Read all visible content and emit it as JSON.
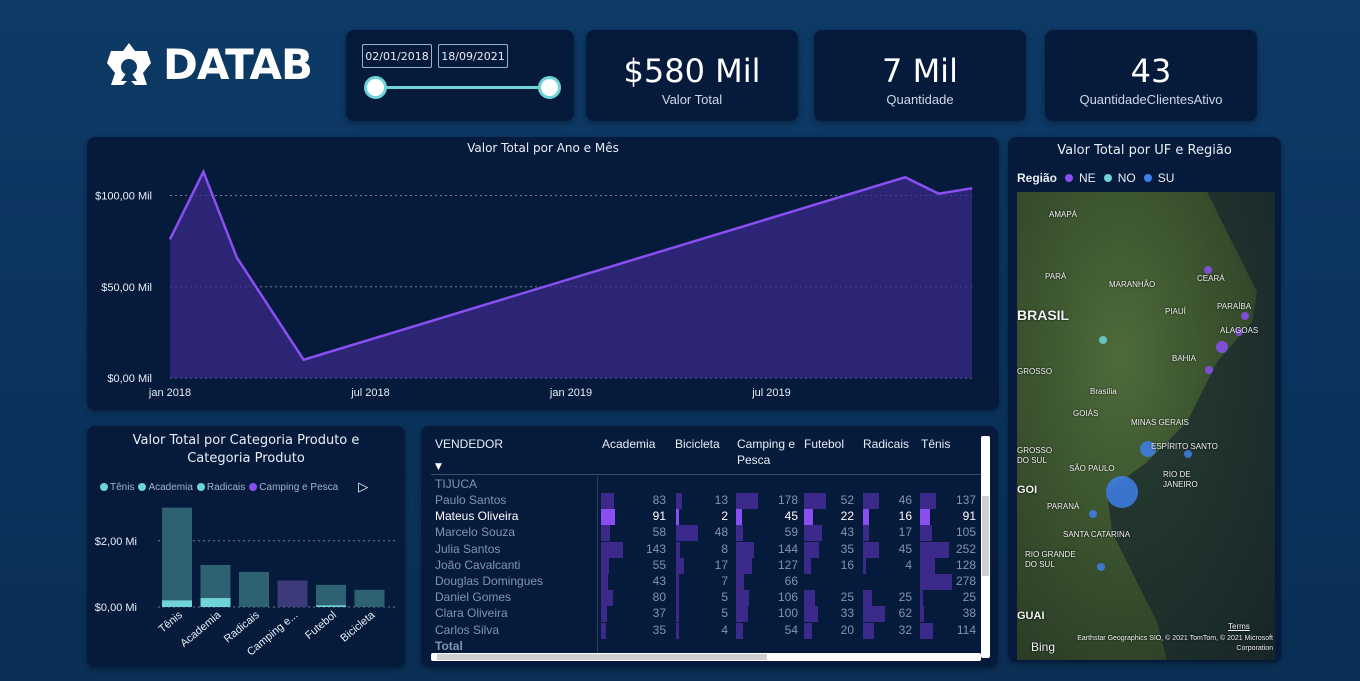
{
  "logo": {
    "text": "DATAB"
  },
  "date_slicer": {
    "start": "02/01/2018",
    "end": "18/09/2021"
  },
  "kpis": [
    {
      "value": "$580 Mil",
      "label": "Valor Total"
    },
    {
      "value": "7 Mil",
      "label": "Quantidade"
    },
    {
      "value": "43",
      "label": "QuantidadeClientesAtivo"
    }
  ],
  "colors": {
    "accent_purple": "#8a4ff0",
    "teal": "#6fd4d6",
    "panel": "#061a3c"
  },
  "chart_data": [
    {
      "type": "area",
      "title": "Valor Total por Ano e Mês",
      "x": [
        "2018-01",
        "2018-02",
        "2018-03",
        "2018-05",
        "2019-11",
        "2019-12",
        "2020-01"
      ],
      "values": [
        76,
        113,
        66,
        10,
        110,
        101,
        104
      ],
      "ylim": [
        0,
        120
      ],
      "yticks": [
        "$0,00 Mil",
        "$50,00 Mil",
        "$100,00 Mil"
      ],
      "ytick_values": [
        0,
        50,
        100
      ],
      "xticks": [
        "jan 2018",
        "jul 2018",
        "jan 2019",
        "jul 2019"
      ],
      "grid": true,
      "color": "#8a4ff0"
    },
    {
      "type": "bar",
      "title": "Valor Total por Categoria Produto e Categoria Produto",
      "title_lines": [
        "Valor Total por Categoria Produto e",
        "Categoria Produto"
      ],
      "legend": [
        {
          "name": "Tênis",
          "color": "#6fd4d6"
        },
        {
          "name": "Academia",
          "color": "#6fd4d6"
        },
        {
          "name": "Radicais",
          "color": "#6fd4d6"
        },
        {
          "name": "Camping e Pesca",
          "color": "#8a4ff0"
        }
      ],
      "categories": [
        "Tênis",
        "Academia",
        "Radicais",
        "Camping e...",
        "Futebol",
        "Bicicleta"
      ],
      "values": [
        3.0,
        1.27,
        1.06,
        0.8,
        0.67,
        0.52
      ],
      "highlight_values": [
        0.2,
        0.27,
        0.0,
        0.0,
        0.05,
        0.0
      ],
      "ylim": [
        0,
        3.2
      ],
      "yticks": [
        "$0,00 Mi",
        "$2,00 Mi"
      ],
      "ytick_values": [
        0,
        2
      ],
      "legend_position": "top-left"
    }
  ],
  "map": {
    "title": "Valor Total por UF e Região",
    "legend_title": "Região",
    "legend": [
      {
        "name": "NE",
        "color": "#8a4ff0"
      },
      {
        "name": "NO",
        "color": "#6fd4d6"
      },
      {
        "name": "SU",
        "color": "#3f7fe8"
      }
    ],
    "labels": [
      "AMAPÁ",
      "PARÁ",
      "MARANHÃO",
      "CEARÁ",
      "PARAÍBA",
      "BRASIL",
      "PIAUÍ",
      "ALAGOAS",
      "BAHIA",
      "GROSSO",
      "Brasília",
      "GOIÁS",
      "MINAS GERAIS",
      "ESPÍRITO SANTO",
      "GROSSO",
      "DO SUL",
      "SÃO PAULO",
      "RIO DE",
      "JANEIRO",
      "PARANÁ",
      "SANTA CATARINA",
      "RIO GRANDE",
      "DO SUL",
      "GUAI",
      "GOI"
    ],
    "attribution": "Earthstar Geographics SIO, © 2021 TomTom, © 2021 Microsoft Corporation",
    "terms": "Terms",
    "bing": "Bing"
  },
  "table": {
    "columns": [
      "VENDEDOR",
      "Academia",
      "Bicicleta",
      "Camping e Pesca",
      "Futebol",
      "Radicais",
      "Tênis"
    ],
    "group": "TIJUCA",
    "rows": [
      {
        "name": "Paulo Santos",
        "values": [
          "83",
          "13",
          "178",
          "52",
          "46",
          "137"
        ]
      },
      {
        "name": "Mateus Oliveira",
        "values": [
          "91",
          "2",
          "45",
          "22",
          "16",
          "91"
        ],
        "highlight": true
      },
      {
        "name": "Marcelo Souza",
        "values": [
          "58",
          "48",
          "59",
          "43",
          "17",
          "105"
        ]
      },
      {
        "name": "Julia Santos",
        "values": [
          "143",
          "8",
          "144",
          "35",
          "45",
          "252"
        ]
      },
      {
        "name": "João Cavalcanti",
        "values": [
          "55",
          "17",
          "127",
          "16",
          "4",
          "128"
        ]
      },
      {
        "name": "Douglas Domingues",
        "values": [
          "43",
          "7",
          "66",
          "",
          "",
          "278"
        ]
      },
      {
        "name": "Daniel Gomes",
        "values": [
          "80",
          "5",
          "106",
          "25",
          "25",
          "25"
        ]
      },
      {
        "name": "Clara Oliveira",
        "values": [
          "37",
          "5",
          "100",
          "33",
          "62",
          "38"
        ]
      },
      {
        "name": "Carlos Silva",
        "values": [
          "35",
          "4",
          "54",
          "20",
          "32",
          "114"
        ]
      }
    ],
    "total_label": "Total"
  }
}
